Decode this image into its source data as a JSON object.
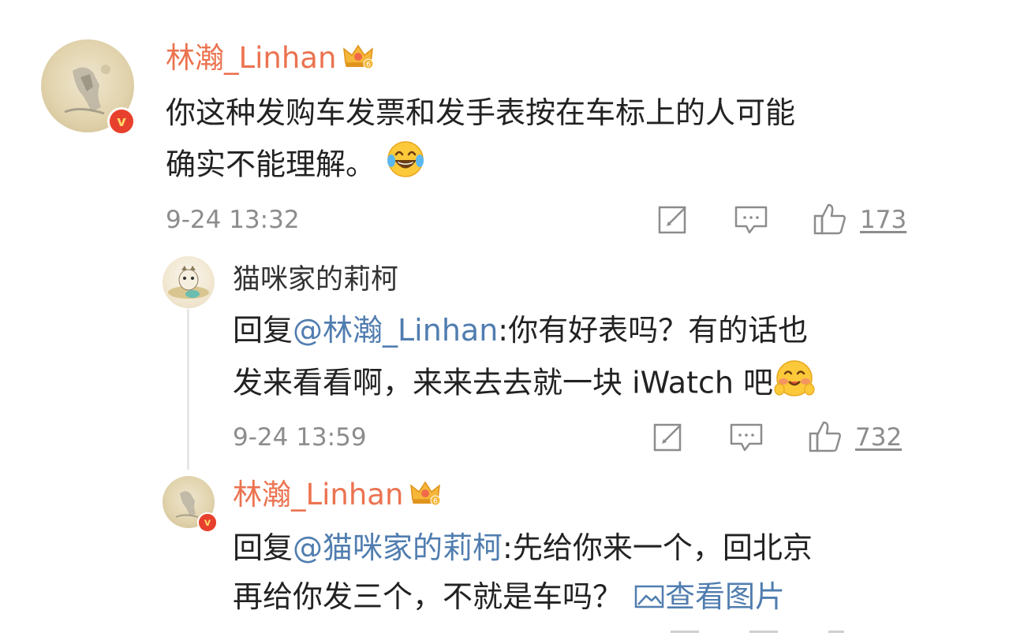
{
  "comment": {
    "username": "林瀚_Linhan",
    "text_line1": "你这种发购车发票和发手表按在车标上的人可能",
    "text_line2": "确实不能理解。",
    "time": "9-24 13:32",
    "likes": "173"
  },
  "reply1": {
    "username": "猫咪家的莉柯",
    "reply_prefix": "回复",
    "mention": "@林瀚_Linhan",
    "text_line1_rest": ":你有好表吗？有的话也",
    "text_line2": "发来看看啊，来来去去就一块 iWatch 吧",
    "time": "9-24 13:59",
    "likes": "732"
  },
  "reply2": {
    "username": "林瀚_Linhan",
    "reply_prefix": "回复",
    "mention": "@猫咪家的莉柯",
    "text_line1_rest": ":先给你来一个，回北京",
    "text_line2": "再给你发三个，不就是车吗？",
    "view_image": "查看图片"
  },
  "colors": {
    "username": "#eb7350",
    "mention": "#507daf",
    "meta": "#8c8c8c",
    "text": "#222222"
  },
  "icons": [
    "verified-badge-icon",
    "vip-crown-icon",
    "laugh-cry-emoji",
    "blush-emoji",
    "repost-icon",
    "comment-icon",
    "like-icon",
    "image-icon"
  ]
}
